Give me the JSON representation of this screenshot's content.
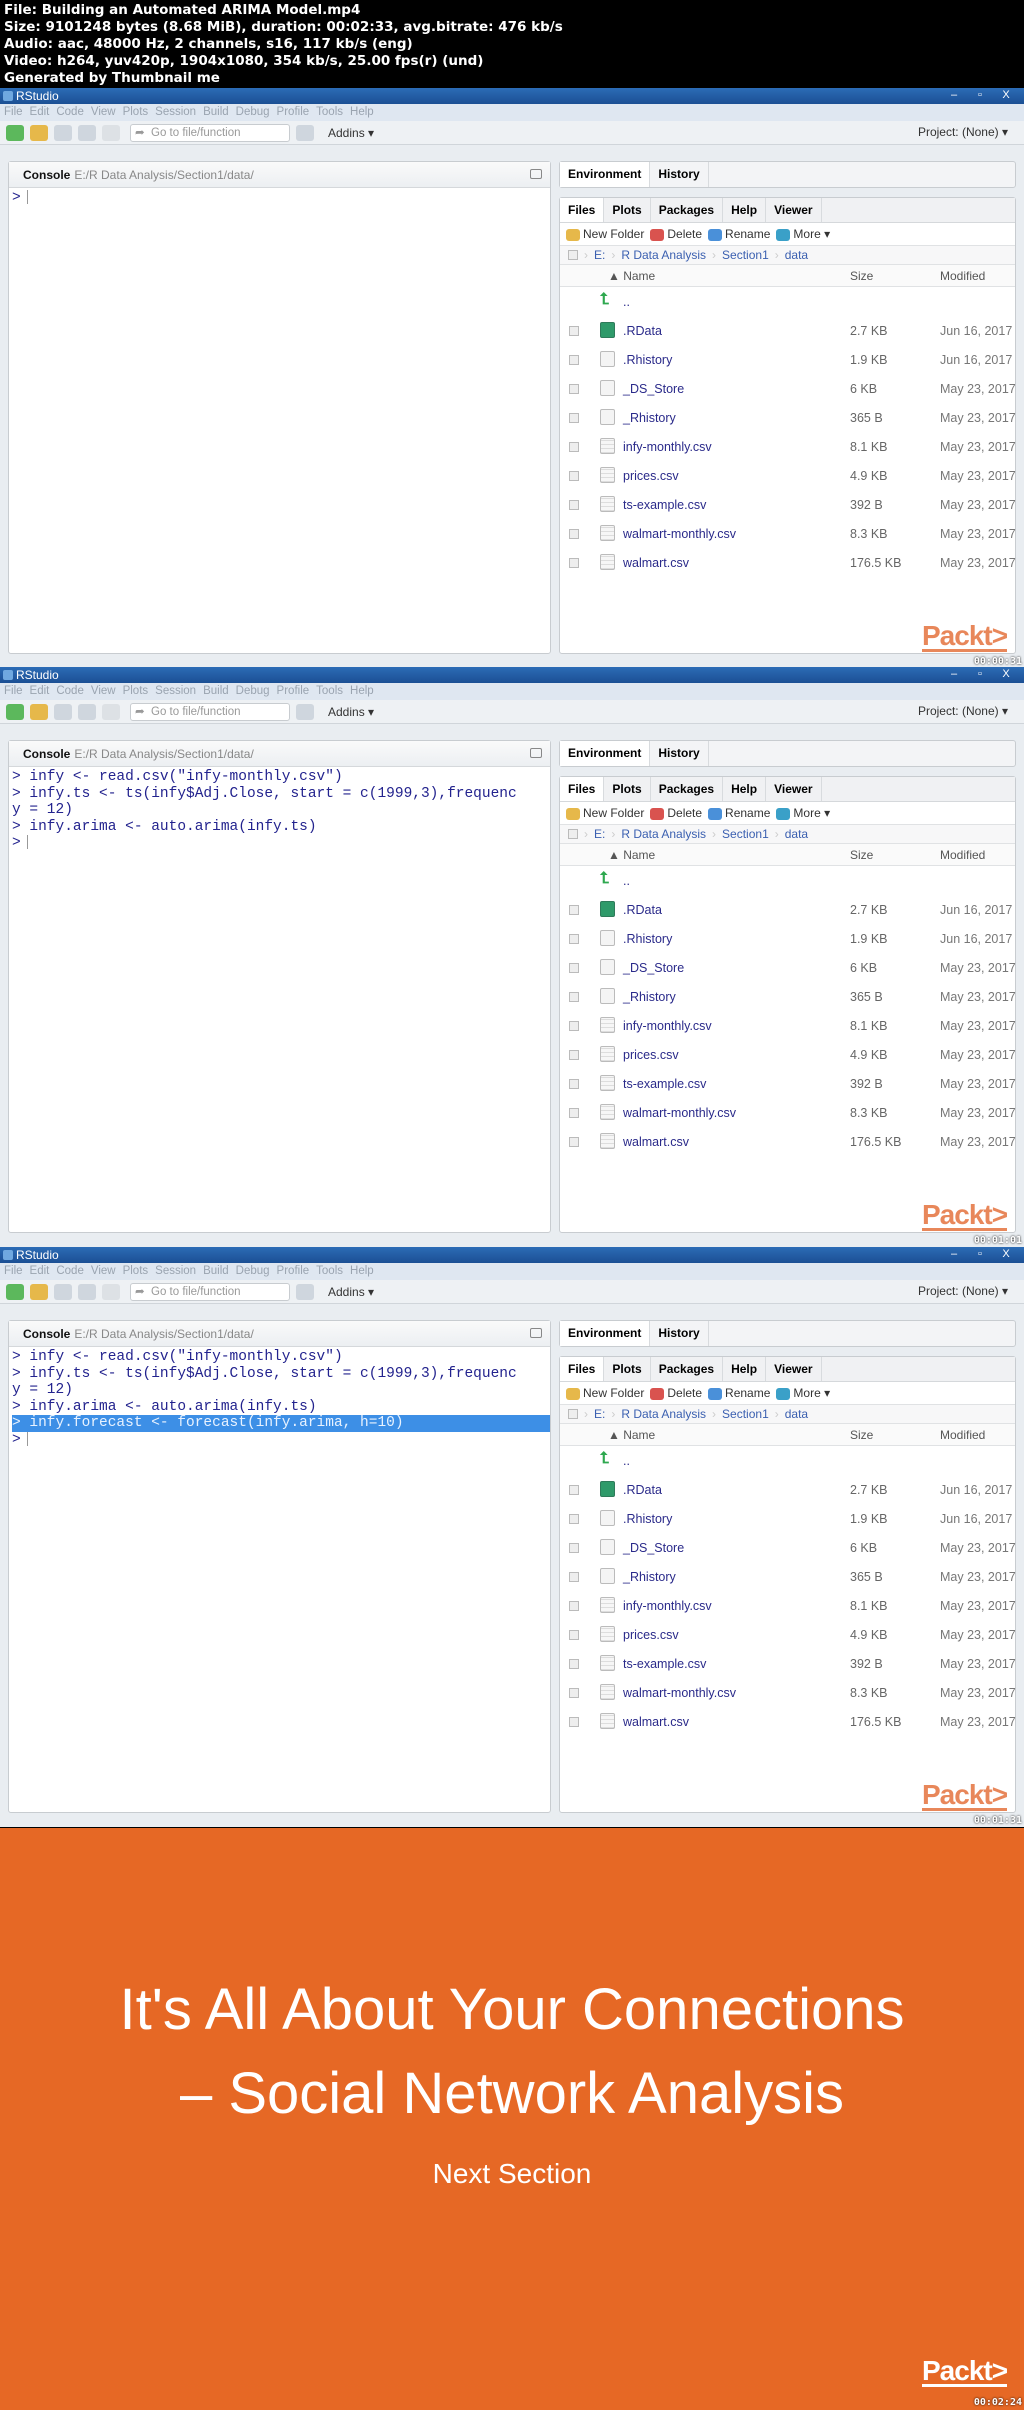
{
  "info_lines": [
    "File: Building an Automated ARIMA Model.mp4",
    "Size: 9101248 bytes (8.68 MiB), duration: 00:02:33, avg.bitrate: 476 kb/s",
    "Audio: aac, 48000 Hz, 2 channels, s16, 117 kb/s (eng)",
    "Video: h264, yuv420p, 1904x1080, 354 kb/s, 25.00 fps(r) (und)",
    "Generated by Thumbnail me"
  ],
  "app": {
    "title": "RStudio",
    "menu": [
      "File",
      "Edit",
      "Code",
      "View",
      "Plots",
      "Session",
      "Build",
      "Debug",
      "Profile",
      "Tools",
      "Help"
    ],
    "goto_placeholder": "Go to file/function",
    "addins": "Addins ▾",
    "project": "Project: (None) ▾",
    "win_controls": [
      "–",
      "▫",
      "X"
    ]
  },
  "console": {
    "label": "Console",
    "path": "E:/R Data Analysis/Section1/data/"
  },
  "env_tabs": [
    "Environment",
    "History"
  ],
  "files_tabs": [
    "Files",
    "Plots",
    "Packages",
    "Help",
    "Viewer"
  ],
  "files_toolbar": {
    "new_folder": "New Folder",
    "delete": "Delete",
    "rename": "Rename",
    "more": "More ▾"
  },
  "breadcrumb": [
    "E:",
    "R Data Analysis",
    "Section1",
    "data"
  ],
  "columns": {
    "name": "▲ Name",
    "size": "Size",
    "modified": "Modified"
  },
  "parent_dir": "..",
  "files": [
    {
      "name": ".RData",
      "size": "2.7 KB",
      "modified": "Jun 16, 2017",
      "type": "rdata"
    },
    {
      "name": ".Rhistory",
      "size": "1.9 KB",
      "modified": "Jun 16, 2017",
      "type": "history"
    },
    {
      "name": "_DS_Store",
      "size": "6 KB",
      "modified": "May 23, 2017",
      "type": "file"
    },
    {
      "name": "_Rhistory",
      "size": "365 B",
      "modified": "May 23, 2017",
      "type": "file"
    },
    {
      "name": "infy-monthly.csv",
      "size": "8.1 KB",
      "modified": "May 23, 2017",
      "type": "csv"
    },
    {
      "name": "prices.csv",
      "size": "4.9 KB",
      "modified": "May 23, 2017",
      "type": "csv"
    },
    {
      "name": "ts-example.csv",
      "size": "392 B",
      "modified": "May 23, 2017",
      "type": "csv"
    },
    {
      "name": "walmart-monthly.csv",
      "size": "8.3 KB",
      "modified": "May 23, 2017",
      "type": "csv"
    },
    {
      "name": "walmart.csv",
      "size": "176.5 KB",
      "modified": "May 23, 2017",
      "type": "csv"
    }
  ],
  "brand": "Packt>",
  "frames": [
    {
      "timestamp": "00:00:31",
      "lines": [
        {
          "text": ">",
          "highlight": false,
          "cursor": true
        }
      ]
    },
    {
      "timestamp": "00:01:01",
      "lines": [
        {
          "text": "> infy <- read.csv(\"infy-monthly.csv\")",
          "highlight": false
        },
        {
          "text": "> infy.ts <- ts(infy$Adj.Close, start = c(1999,3),frequenc",
          "highlight": false
        },
        {
          "text": "y = 12)",
          "highlight": false
        },
        {
          "text": "> infy.arima <- auto.arima(infy.ts)",
          "highlight": false
        },
        {
          "text": ">",
          "highlight": false,
          "cursor": true
        }
      ]
    },
    {
      "timestamp": "00:01:31",
      "lines": [
        {
          "text": "> infy <- read.csv(\"infy-monthly.csv\")",
          "highlight": false
        },
        {
          "text": "> infy.ts <- ts(infy$Adj.Close, start = c(1999,3),frequenc",
          "highlight": false
        },
        {
          "text": "y = 12)",
          "highlight": false
        },
        {
          "text": "> infy.arima <- auto.arima(infy.ts)",
          "highlight": false
        },
        {
          "text": "> infy.forecast <- forecast(infy.arima, h=10)",
          "highlight": true
        },
        {
          "text": ">",
          "highlight": false,
          "cursor": true
        }
      ]
    }
  ],
  "slide": {
    "title_line1": "It's All About Your Connections",
    "title_line2": "– Social Network Analysis",
    "subtitle": "Next Section",
    "timestamp": "00:02:24",
    "background": "#e66825"
  }
}
